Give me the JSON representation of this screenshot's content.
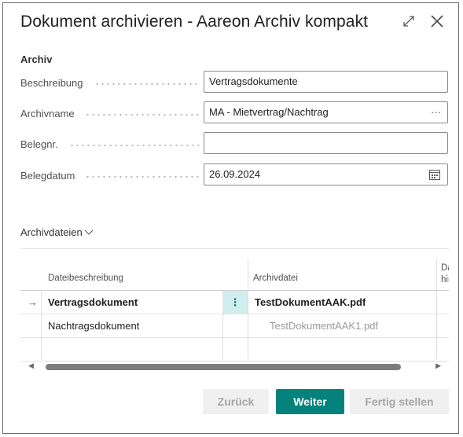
{
  "dialog": {
    "title": "Dokument archivieren - Aareon Archiv kompakt",
    "expand_icon": "expand-icon",
    "close_icon": "close-icon"
  },
  "archiv": {
    "section_label": "Archiv",
    "fields": [
      {
        "label": "Beschreibung",
        "value": "Vertragsdokumente"
      },
      {
        "label": "Archivname",
        "value": "MA - Mietvertrag/Nachtrag",
        "suffix": "···"
      },
      {
        "label": "Belegnr.",
        "value": ""
      },
      {
        "label": "Belegdatum",
        "value": "26.09.2024",
        "icon": "calendar-icon"
      }
    ]
  },
  "archivdateien": {
    "label": "Archivdateien",
    "columns": [
      "Dateibeschreibung",
      "Archivdatei",
      "Da",
      "hir"
    ],
    "rows": [
      {
        "marker": "→",
        "beschreibung": "Vertragsdokument",
        "datei": "TestDokumentAAK.pdf",
        "selected": true,
        "menu": "⋮"
      },
      {
        "marker": "",
        "beschreibung": "Nachtragsdokument",
        "datei": "TestDokumentAAK1.pdf",
        "selected": false,
        "menu": ""
      },
      {
        "marker": "",
        "beschreibung": "",
        "datei": "",
        "selected": false,
        "menu": ""
      }
    ],
    "scroll_left": "◀",
    "scroll_right": "▶"
  },
  "footer": {
    "back_label": "Zurück",
    "next_label": "Weiter",
    "finish_label": "Fertig stellen"
  },
  "colors": {
    "accent": "#05827c",
    "selected_menu_bg": "#cfeeed"
  }
}
